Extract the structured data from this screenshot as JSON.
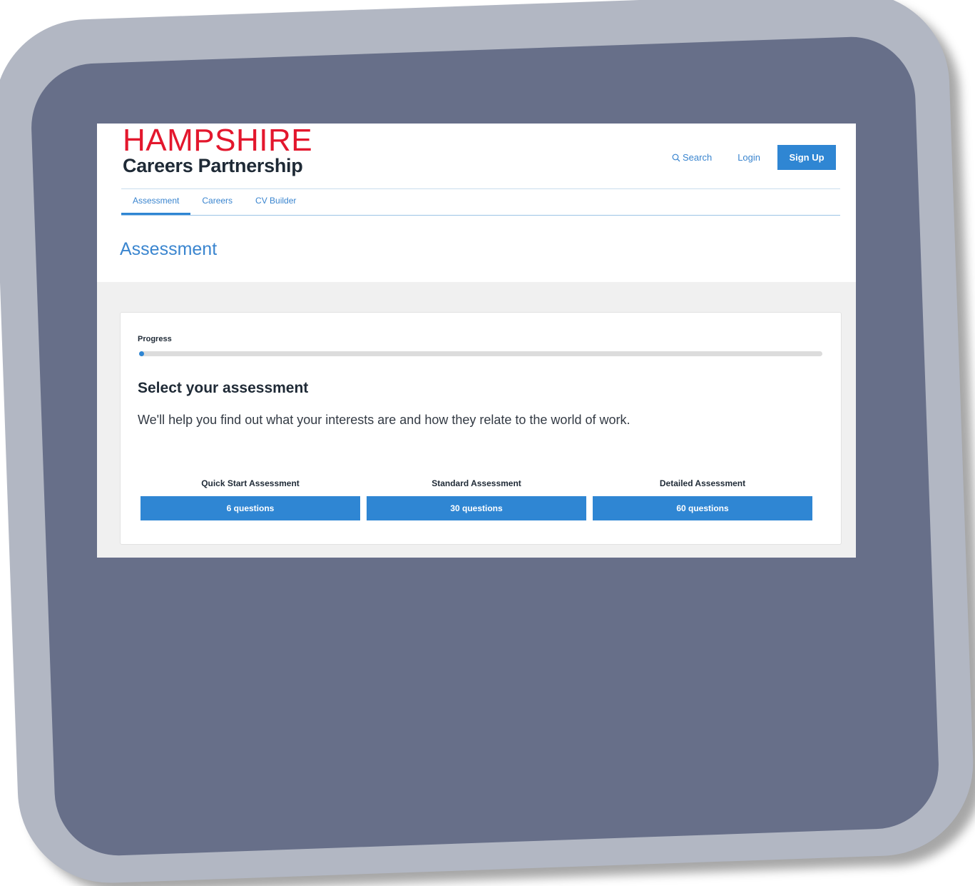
{
  "logo": {
    "line1": "HAMPSHIRE",
    "line2": "Careers Partnership"
  },
  "header": {
    "search_label": "Search",
    "login_label": "Login",
    "signup_label": "Sign Up"
  },
  "tabs": [
    {
      "label": "Assessment",
      "active": true
    },
    {
      "label": "Careers",
      "active": false
    },
    {
      "label": "CV Builder",
      "active": false
    }
  ],
  "page_title": "Assessment",
  "card": {
    "progress_label": "Progress",
    "progress_percent": 0,
    "title": "Select your assessment",
    "description": "We'll help you find out what your interests are and how they relate to the world of work.",
    "options": [
      {
        "label": "Quick Start Assessment",
        "button": "6 questions"
      },
      {
        "label": "Standard Assessment",
        "button": "30 questions"
      },
      {
        "label": "Detailed Assessment",
        "button": "60 questions"
      }
    ]
  },
  "colors": {
    "brand_red": "#e3172d",
    "accent_blue": "#2f86d3",
    "link_blue": "#3a85cf",
    "frame_outer": "#b2b7c3",
    "frame_inner": "#676f89"
  },
  "icons": {
    "search": "search-icon"
  }
}
